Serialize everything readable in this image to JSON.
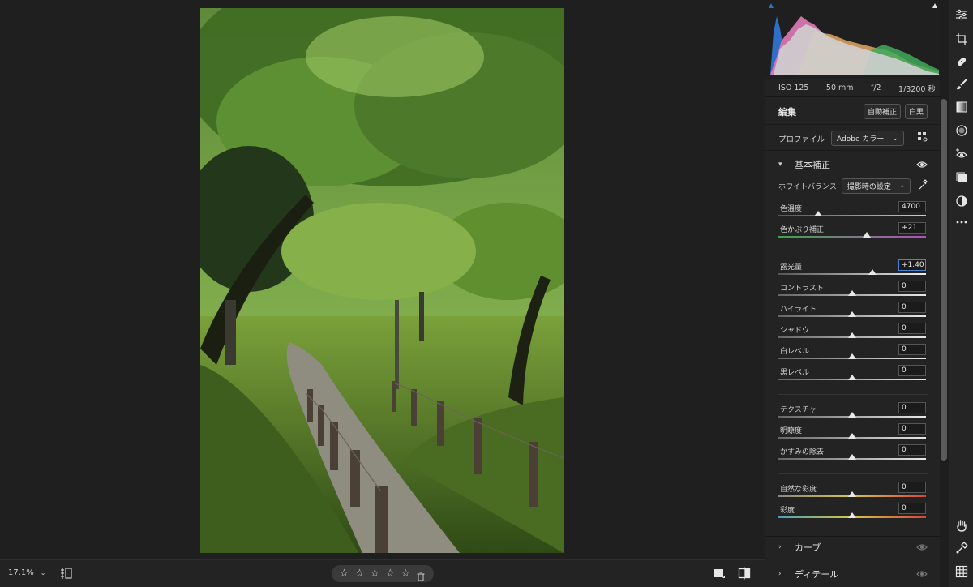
{
  "exif": {
    "iso": "ISO 125",
    "focal": "50 mm",
    "aperture": "f/2",
    "shutter": "1/3200 秒"
  },
  "edit": {
    "title": "編集",
    "auto_label": "自動補正",
    "bw_label": "白黒"
  },
  "profile": {
    "label": "プロファイル",
    "value": "Adobe カラー"
  },
  "basic": {
    "title": "基本補正"
  },
  "white_balance": {
    "label": "ホワイトバランス",
    "value": "撮影時の設定"
  },
  "sliders": {
    "temp": {
      "label": "色温度",
      "value": "4700",
      "level": 0.27
    },
    "tint": {
      "label": "色かぶり補正",
      "value": "+21",
      "level": 0.6
    },
    "exposure": {
      "label": "露光量",
      "value": "+1.40",
      "level": 0.64
    },
    "contrast": {
      "label": "コントラスト",
      "value": "0",
      "level": 0.5
    },
    "highlights": {
      "label": "ハイライト",
      "value": "0",
      "level": 0.5
    },
    "shadows": {
      "label": "シャドウ",
      "value": "0",
      "level": 0.5
    },
    "whites": {
      "label": "白レベル",
      "value": "0",
      "level": 0.5
    },
    "blacks": {
      "label": "黒レベル",
      "value": "0",
      "level": 0.5
    },
    "texture": {
      "label": "テクスチャ",
      "value": "0",
      "level": 0.5
    },
    "clarity": {
      "label": "明瞭度",
      "value": "0",
      "level": 0.5
    },
    "dehaze": {
      "label": "かすみの除去",
      "value": "0",
      "level": 0.5
    },
    "vibrance": {
      "label": "自然な彩度",
      "value": "0",
      "level": 0.5
    },
    "saturation": {
      "label": "彩度",
      "value": "0",
      "level": 0.5
    }
  },
  "sections": {
    "curve": "カーブ",
    "detail": "ディテール"
  },
  "zoom": {
    "value": "17.1%"
  },
  "rating": {
    "stars": 0,
    "max": 5
  },
  "colors": {
    "accent": "#4a84d7",
    "panel": "#232323",
    "canvas": "#1f1f1f"
  },
  "icons": [
    "adjust-icon",
    "crop-icon",
    "heal-icon",
    "brush-icon",
    "linear-gradient-icon",
    "radial-gradient-icon",
    "red-eye-icon",
    "presets-icon",
    "mask-icon",
    "more-icon",
    "hand-icon",
    "sampler-icon",
    "grid-icon"
  ]
}
